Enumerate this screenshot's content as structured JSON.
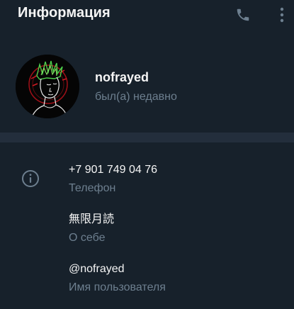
{
  "header": {
    "title": "Информация",
    "icons": [
      "phone-icon",
      "more-vertical-icon"
    ]
  },
  "profile": {
    "name": "nofrayed",
    "status": "был(а) недавно"
  },
  "info": {
    "phone_value": "+7 901 749 04 76",
    "phone_label": "Телефон",
    "about_value": "無限月読",
    "about_label": "О себе",
    "username_value": "@nofrayed",
    "username_label": "Имя пользователя"
  },
  "colors": {
    "background": "#17212b",
    "divider": "#232e3c",
    "secondary_text": "#6d7f8f",
    "icon": "#6d7f8f"
  }
}
